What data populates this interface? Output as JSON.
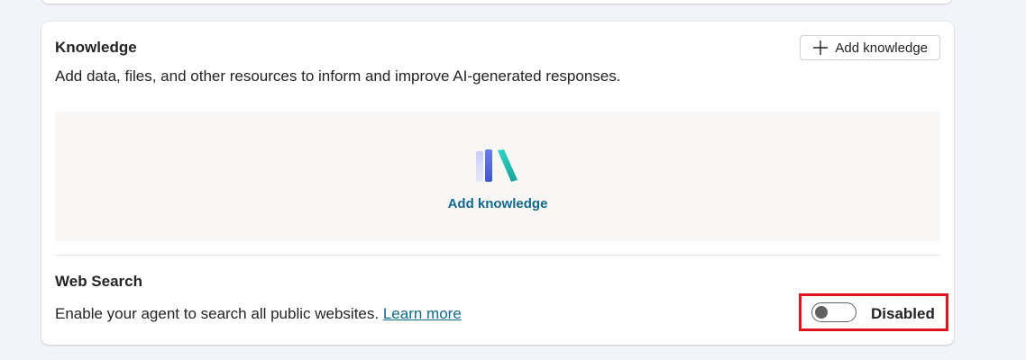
{
  "knowledge": {
    "title": "Knowledge",
    "description": "Add data, files, and other resources to inform and improve AI-generated responses.",
    "add_button_label": "Add knowledge",
    "empty_state_link": "Add knowledge",
    "icon": "books-icon"
  },
  "web_search": {
    "title": "Web Search",
    "description": "Enable your agent to search all public websites.",
    "learn_more": "Learn more",
    "toggle_state": "Disabled",
    "enabled": false
  },
  "colors": {
    "link": "#116a8e",
    "highlight_border": "#e0141d",
    "empty_area_bg": "#f8f7f6",
    "page_bg": "#f2f4f9"
  }
}
